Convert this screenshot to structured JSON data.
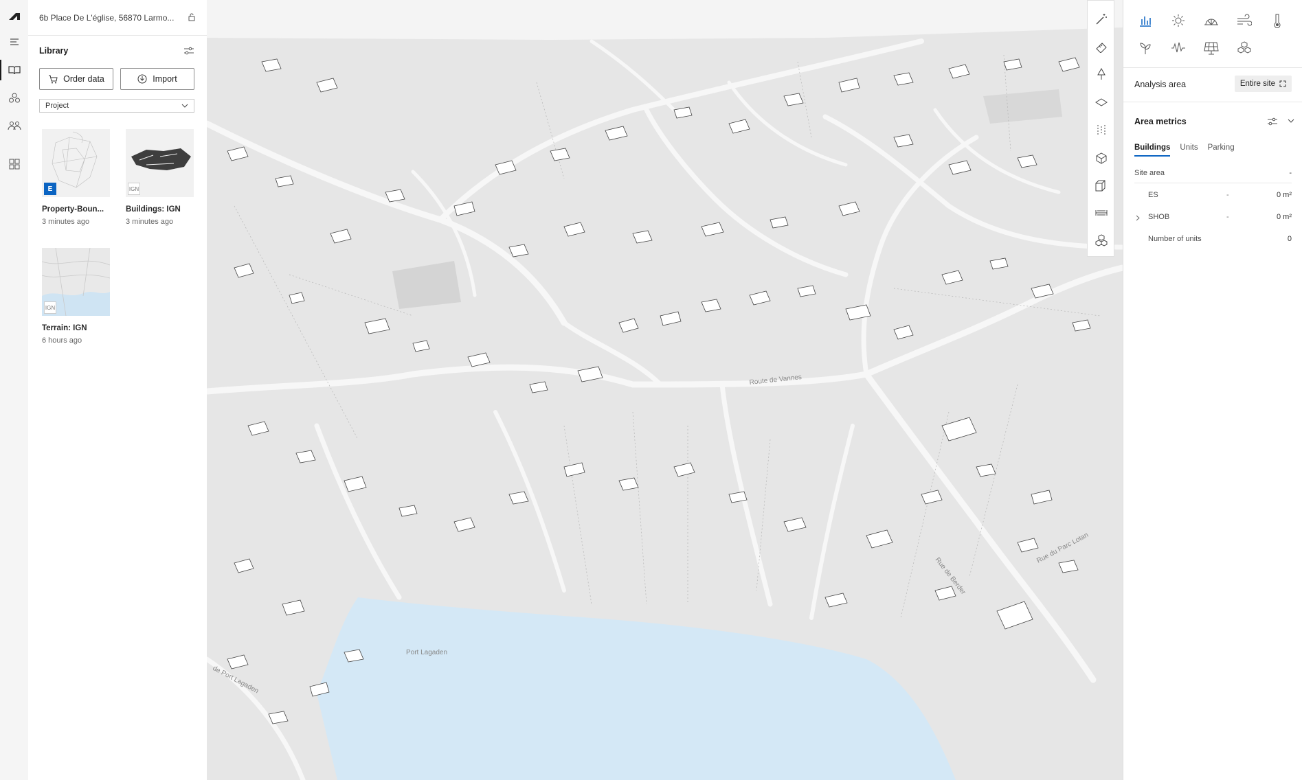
{
  "rail": {
    "items": [
      {
        "name": "app-logo-icon"
      },
      {
        "name": "menu-icon"
      },
      {
        "name": "library-book-icon",
        "active": true
      },
      {
        "name": "models-icon"
      },
      {
        "name": "people-icon"
      },
      {
        "name": "dashboard-icon"
      }
    ]
  },
  "library": {
    "address": "6b Place De L'église, 56870 Larmo...",
    "title": "Library",
    "order_button": "Order data",
    "import_button": "Import",
    "filter_value": "Project",
    "cards": [
      {
        "title": "Property-Boun...",
        "subtitle": "3 minutes ago",
        "badge": "E"
      },
      {
        "title": "Buildings: IGN",
        "subtitle": "3 minutes ago",
        "badge": "IGN"
      },
      {
        "title": "Terrain: IGN",
        "subtitle": "6 hours ago",
        "badge": "IGN"
      }
    ]
  },
  "map": {
    "labels": {
      "port": "Port Lagaden",
      "rue_berder": "Rue de Berder",
      "rue_parc": "Rue du Parc Lotan",
      "route_vannes": "Route de Vannes",
      "rue_port": "de Port Lagaden"
    },
    "water_color": "#d4e8f6",
    "ground_color": "#e6e6e6"
  },
  "toolbar": {
    "tools": [
      "magic-wand-icon",
      "ruler-icon",
      "tree-icon",
      "layer-icon",
      "height-icon",
      "box-icon",
      "cube-icon",
      "width-icon",
      "stack-icon"
    ]
  },
  "analysis": {
    "top_icons": [
      "bar-chart-icon",
      "sun-icon",
      "daylight-icon",
      "wind-icon",
      "thermometer-icon",
      "plant-icon",
      "noise-icon",
      "solar-panel-icon",
      "blocks-icon"
    ],
    "analysis_area_label": "Analysis area",
    "analysis_area_value": "Entire site",
    "area_metrics_label": "Area metrics",
    "tabs": [
      "Buildings",
      "Units",
      "Parking"
    ],
    "active_tab": "Buildings",
    "site_area_label": "Site area",
    "site_area_value": "-",
    "rows": [
      {
        "label": "ES",
        "dash": "-",
        "value": "0 m²"
      },
      {
        "label": "SHOB",
        "dash": "-",
        "value": "0 m²"
      },
      {
        "label": "Number of units",
        "dash": "",
        "value": "0"
      }
    ],
    "accent": "#0b64c2"
  }
}
